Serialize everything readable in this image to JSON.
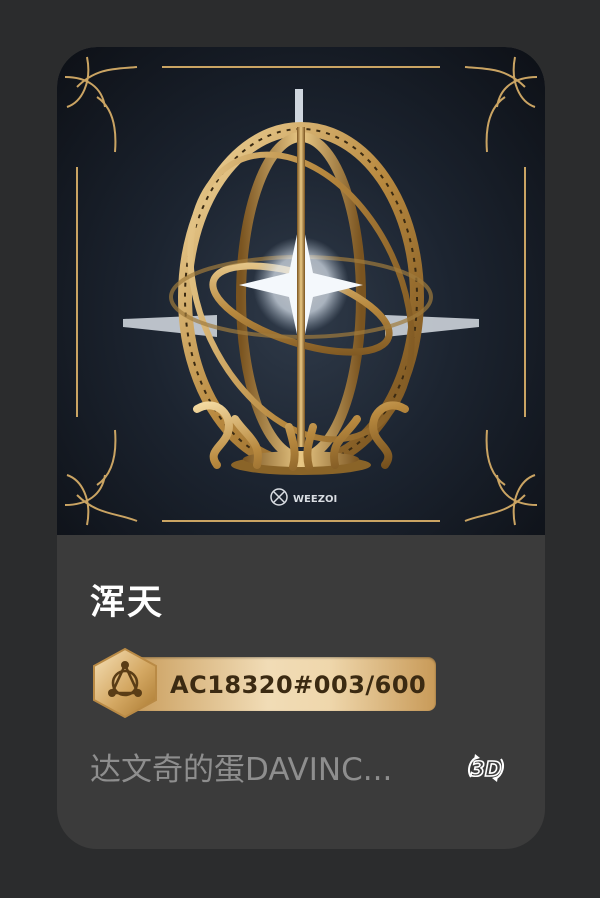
{
  "card": {
    "artwork_watermark": "WEEZOI",
    "title": "浑天",
    "badge": {
      "icon": "blockchain-hex-icon",
      "serial": "AC18320#003/600"
    },
    "subtitle": "达文奇的蛋DAVINC...",
    "model_icon": "3d-rotate-icon",
    "colors": {
      "page_bg": "#2b2c2d",
      "card_bg": "#3b3b3b",
      "gold": "#d9b375",
      "subtitle": "#8e8e8e"
    }
  }
}
